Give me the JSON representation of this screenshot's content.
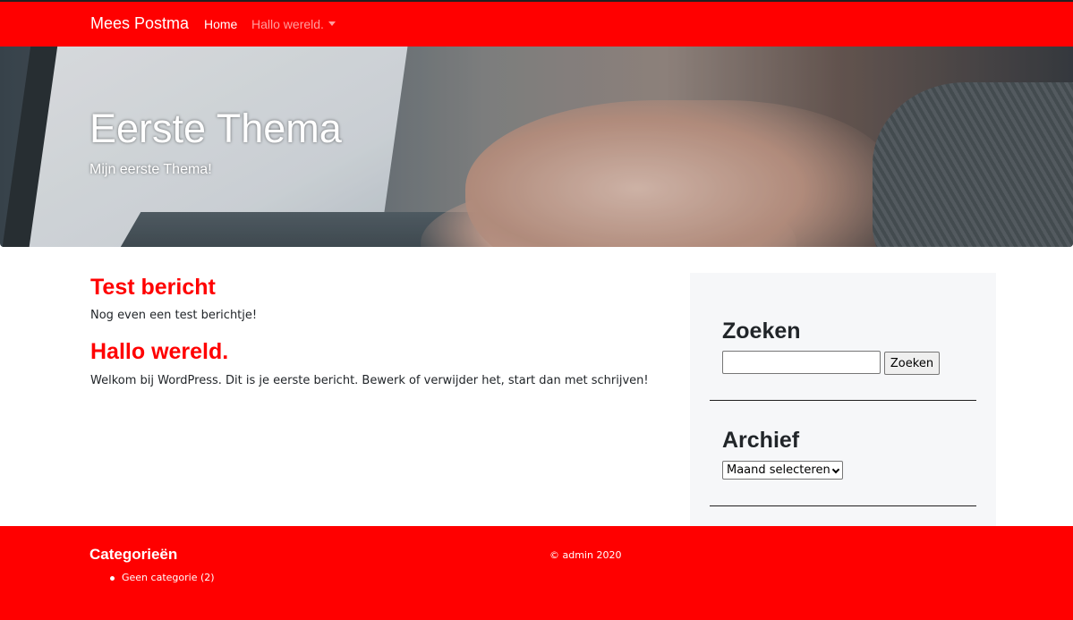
{
  "navbar": {
    "brand": "Mees Postma",
    "items": [
      {
        "label": "Home",
        "active": true
      },
      {
        "label": "Hallo wereld.",
        "has_dropdown": true
      }
    ]
  },
  "hero": {
    "title": "Eerste Thema",
    "subtitle": "Mijn eerste Thema!"
  },
  "posts": [
    {
      "title": "Test bericht",
      "excerpt": "Nog even een test berichtje!"
    },
    {
      "title": "Hallo wereld.",
      "excerpt": "Welkom bij WordPress. Dit is je eerste bericht. Bewerk of verwijder het, start dan met schrijven!"
    }
  ],
  "sidebar": {
    "search": {
      "title": "Zoeken",
      "value": "",
      "button_label": "Zoeken"
    },
    "archive": {
      "title": "Archief",
      "selected": "Maand selecteren"
    }
  },
  "footer": {
    "categories_title": "Categorieën",
    "categories": [
      {
        "label": "Geen categorie (2)"
      }
    ],
    "copyright": "© admin 2020"
  },
  "colors": {
    "accent": "#ff0000",
    "sidebar_bg": "#f6f7f9",
    "text": "#212529"
  }
}
